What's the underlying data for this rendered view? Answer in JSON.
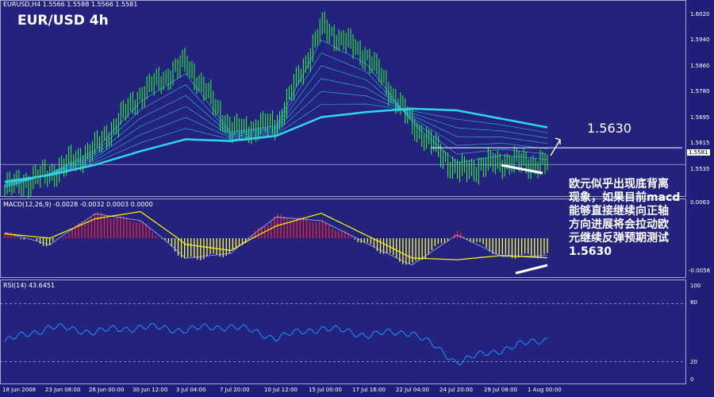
{
  "header": {
    "price_line": "EURUSD,H4  1.5566 1.5588 1.5566 1.5581",
    "macd_line": "MACD(12,26,9) -0.0028 -0.0032 0.0003 0.0000",
    "rsi_line": "RSI(14) 43.6451",
    "chart_title": "EUR/USD 4h",
    "level_label": "1.5630"
  },
  "price_axis": [
    "1.6020",
    "1.5940",
    "1.5860",
    "1.5780",
    "1.5695",
    "1.5615",
    "1.5535"
  ],
  "current_price": "1.5581",
  "macd_axis": [
    "0.0063",
    "-0.0058"
  ],
  "rsi_axis": [
    "100",
    "80",
    "20",
    "0"
  ],
  "time_axis": [
    "18 Jun 2008",
    "23 Jun 08:00",
    "26 Jun 00:00",
    "30 Jun 12:00",
    "3 Jul 04:00",
    "7 Jul 20:00",
    "10 Jul 12:00",
    "15 Jul 00:00",
    "17 Jul 16:00",
    "22 Jul 04:00",
    "24 Jul 20:00",
    "29 Jul 08:00",
    "1 Aug 00:00"
  ],
  "annotation": [
    "欧元似乎出现底背离",
    "现象，如果目前macd",
    "能够直接继续向正轴",
    "方向进展将会拉动欧",
    "元继续反弹预期测试",
    "1.5630"
  ],
  "colors": {
    "background": "#1f1f7a",
    "candles": "#33ff33",
    "ma": "#33d6e6",
    "macd_pos": "#ff2222",
    "macd_neg": "#ffff33",
    "signal": "#ffff00",
    "rsi": "#1e90ff"
  },
  "chart_data": {
    "type": "line",
    "symbol": "EURUSD",
    "timeframe": "H4",
    "ylim": [
      1.5495,
      1.6055
    ],
    "x": [
      "18 Jun 2008",
      "23 Jun 08:00",
      "26 Jun 00:00",
      "30 Jun 12:00",
      "3 Jul 04:00",
      "7 Jul 20:00",
      "10 Jul 12:00",
      "15 Jul 00:00",
      "17 Jul 16:00",
      "22 Jul 04:00",
      "24 Jul 20:00",
      "29 Jul 08:00",
      "1 Aug 00:00"
    ],
    "series": [
      {
        "values": [
          1.551,
          1.5555,
          1.563,
          1.579,
          1.588,
          1.568,
          1.57,
          1.5985,
          1.59,
          1.57,
          1.556,
          1.559,
          1.558
        ]
      },
      {
        "values": [
          1.553,
          1.555,
          1.558,
          1.562,
          1.5655,
          1.565,
          1.5665,
          1.572,
          1.5735,
          1.5745,
          1.574,
          1.5715,
          1.569
        ]
      }
    ],
    "horizontal_line": 1.563,
    "rsi": {
      "ylim": [
        0,
        100
      ],
      "levels": [
        80,
        20
      ],
      "values": [
        41,
        56,
        51,
        56,
        53,
        57,
        45,
        55,
        48,
        51,
        20,
        33,
        44
      ]
    },
    "macd": {
      "ylim": [
        -0.0058,
        0.0063
      ],
      "histogram": [
        0.001,
        -0.0012,
        0.0045,
        0.003,
        -0.0035,
        -0.0025,
        0.004,
        0.003,
        -0.001,
        -0.0045,
        0.001,
        -0.003,
        -0.0028
      ],
      "signal": [
        0.0008,
        0.0,
        0.0035,
        0.0048,
        -0.001,
        -0.002,
        0.0022,
        0.0045,
        0.0005,
        -0.0032,
        -0.0035,
        -0.0028,
        -0.0032
      ]
    }
  }
}
